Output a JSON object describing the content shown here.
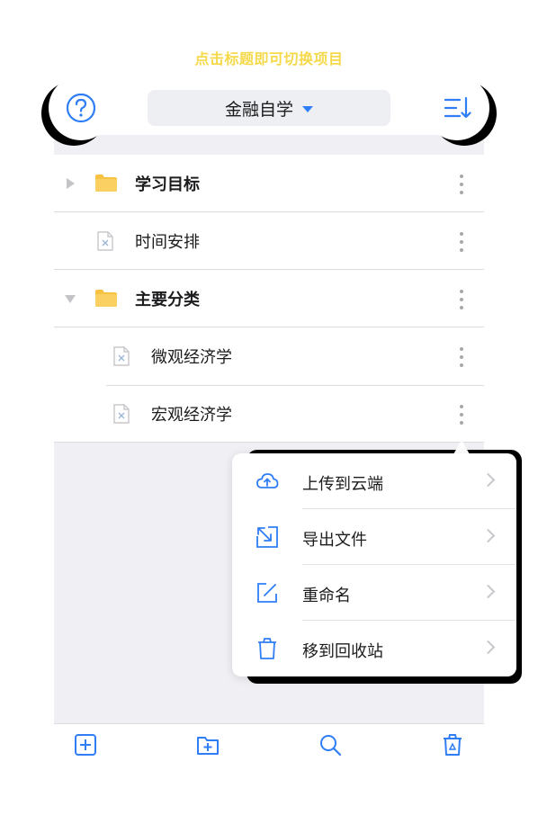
{
  "hint_text": "点击标题即可切换项目",
  "header": {
    "project_title": "金融自学"
  },
  "tree": {
    "rows": [
      {
        "label": "学习目标",
        "type": "folder",
        "expanded": false
      },
      {
        "label": "时间安排",
        "type": "file"
      },
      {
        "label": "主要分类",
        "type": "folder",
        "expanded": true
      },
      {
        "label": "微观经济学",
        "type": "file",
        "child": true
      },
      {
        "label": "宏观经济学",
        "type": "file",
        "child": true
      }
    ]
  },
  "context_menu": {
    "items": [
      {
        "label": "上传到云端",
        "icon": "cloud-upload-icon"
      },
      {
        "label": "导出文件",
        "icon": "export-icon"
      },
      {
        "label": "重命名",
        "icon": "edit-icon"
      },
      {
        "label": "移到回收站",
        "icon": "trash-icon"
      }
    ]
  },
  "bottom_bar": {
    "icons": [
      "new-file-icon",
      "new-folder-icon",
      "search-icon",
      "recycle-bin-icon"
    ]
  },
  "colors": {
    "accent": "#2f7ef5",
    "hint": "#f5d94a",
    "folder": "#f7c244"
  }
}
